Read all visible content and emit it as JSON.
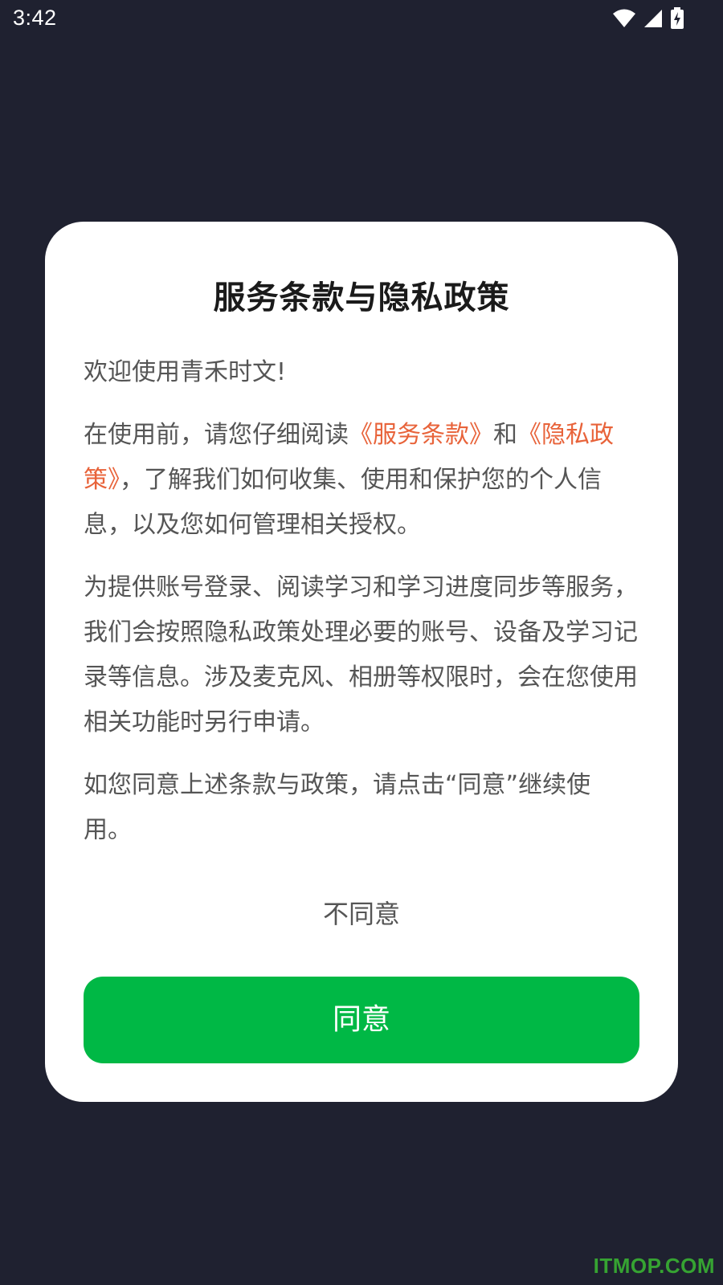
{
  "status_bar": {
    "time": "3:42",
    "icons": [
      "wifi-icon",
      "signal-icon",
      "battery-charging-icon"
    ]
  },
  "dialog": {
    "title": "服务条款与隐私政策",
    "welcome": "欢迎使用青禾时文!",
    "paragraph1": {
      "prefix": "在使用前，请您仔细阅读",
      "terms_link": "《服务条款》",
      "conjunction": "和",
      "privacy_link": "《隐私政策》",
      "suffix": "，了解我们如何收集、使用和保护您的个人信息，以及您如何管理相关授权。"
    },
    "paragraph2": "为提供账号登录、阅读学习和学习进度同步等服务，我们会按照隐私政策处理必要的账号、设备及学习记录等信息。涉及麦克风、相册等权限时，会在您使用相关功能时另行申请。",
    "paragraph3": "如您同意上述条款与政策，请点击“同意”继续使用。",
    "disagree_label": "不同意",
    "agree_label": "同意"
  },
  "watermark": "ITMOP.COM",
  "colors": {
    "background": "#1f2130",
    "link": "#e8633a",
    "agree_button": "#00b845"
  }
}
